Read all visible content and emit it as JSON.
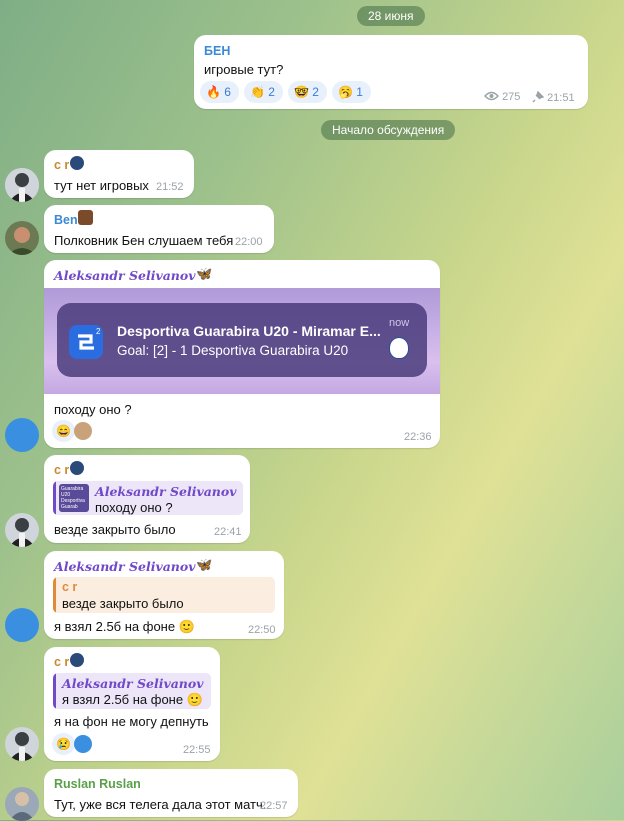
{
  "date_label": "28 июня",
  "discussion_label": "Начало обсуждения",
  "channel_post": {
    "author": "БЕН",
    "text": "игровые тут?",
    "reactions": [
      {
        "emoji": "🔥",
        "count": "6"
      },
      {
        "emoji": "👏",
        "count": "2"
      },
      {
        "emoji": "🤓",
        "count": "2"
      },
      {
        "emoji": "🥱",
        "count": "1"
      }
    ],
    "views": "275",
    "time": "21:51"
  },
  "messages": [
    {
      "author": "c r",
      "text": "тут нет игровых",
      "time": "21:52"
    },
    {
      "author": "Ben",
      "text": "Полковник Бен слушаем тебя",
      "time": "22:00"
    },
    {
      "author": "Aleksandr Selivanov",
      "notification": {
        "title": "Desportiva Guarabira U20 - Miramar E...",
        "body": "Goal: [2] - 1 Desportiva Guarabira U20",
        "time": "now"
      },
      "text": "походу оно ?",
      "reactions": [
        "😄"
      ],
      "time": "22:36"
    },
    {
      "author": "c r",
      "reply_author": "Aleksandr Selivanov",
      "reply_text": "походу оно ?",
      "reply_thumb_text": "Guarabira U20 Desportiva Guarab",
      "text": "везде закрыто было",
      "time": "22:41"
    },
    {
      "author": "Aleksandr Selivanov",
      "reply_author": "c r",
      "reply_text": "везде закрыто было",
      "text": "я взял 2.5б на фоне 🙂",
      "time": "22:50"
    },
    {
      "author": "c r",
      "reply_author": "Aleksandr Selivanov",
      "reply_text": "я взял 2.5б на фоне 🙂",
      "text": "я на фон не могу депнуть",
      "reactions": [
        "😢"
      ],
      "time": "22:55"
    },
    {
      "author": "Ruslan Ruslan",
      "text": "Тут, уже вся телега дала этот матч.",
      "time": "22:57"
    }
  ],
  "colors": {
    "name_cr": "#c98a2e",
    "name_ben": "#3a8ad5",
    "name_aleksandr": "#7048c8",
    "name_ruslan": "#5aa04a",
    "reaction_bg": "#e8f1fb",
    "reaction_text": "#3a7bd5"
  }
}
